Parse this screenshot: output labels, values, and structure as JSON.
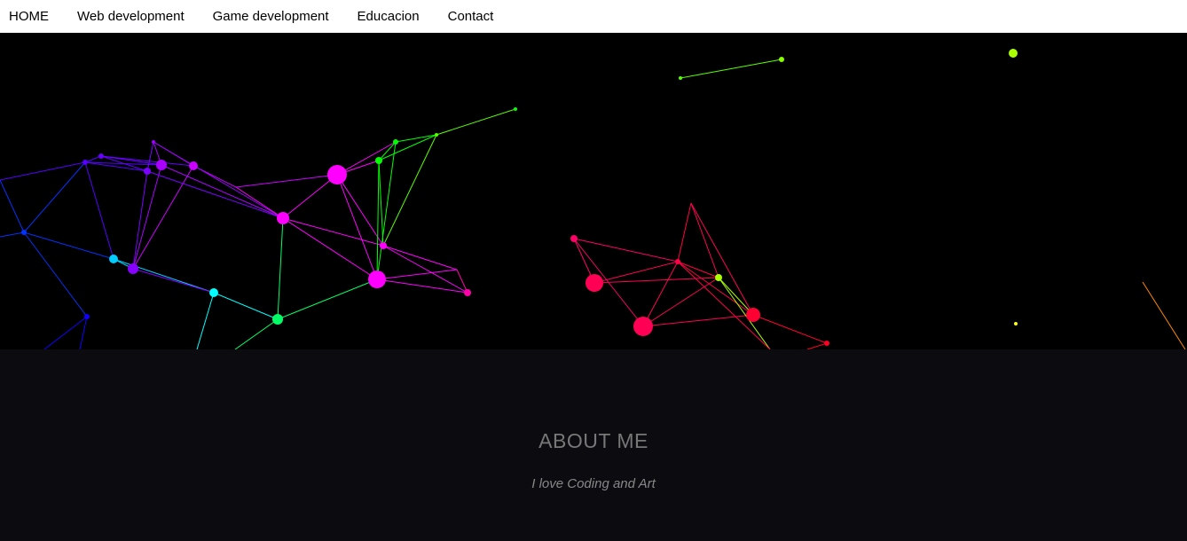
{
  "nav": {
    "items": [
      {
        "label": "HOME"
      },
      {
        "label": "Web development"
      },
      {
        "label": "Game development"
      },
      {
        "label": "Educacion"
      },
      {
        "label": "Contact"
      }
    ]
  },
  "about": {
    "title": "ABOUT ME",
    "subtitle": "I love Coding and Art"
  },
  "hero": {
    "background": "#000000",
    "palette": [
      "#7a00ff",
      "#ff00ff",
      "#0033ff",
      "#00ffff",
      "#00ff44",
      "#ff0055",
      "#aaff00",
      "#ff8800"
    ]
  }
}
